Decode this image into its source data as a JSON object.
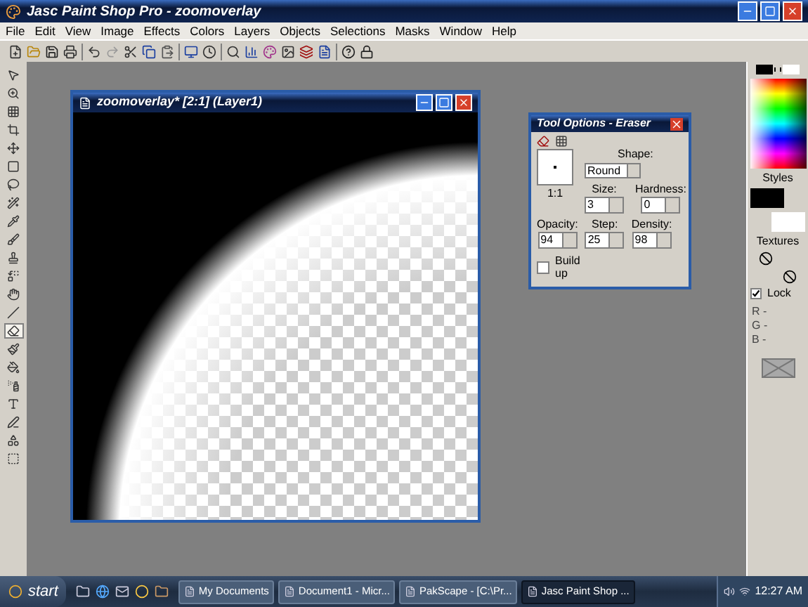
{
  "window": {
    "title": "Jasc Paint Shop Pro - zoomoverlay"
  },
  "menu": [
    "File",
    "Edit",
    "View",
    "Image",
    "Effects",
    "Colors",
    "Layers",
    "Objects",
    "Selections",
    "Masks",
    "Window",
    "Help"
  ],
  "tools": [
    {
      "kind": "pointer",
      "selected": false
    },
    {
      "kind": "zoom",
      "selected": false
    },
    {
      "kind": "deform",
      "selected": false
    },
    {
      "kind": "crop",
      "selected": false
    },
    {
      "kind": "move",
      "selected": false
    },
    {
      "kind": "selection",
      "selected": false
    },
    {
      "kind": "lasso",
      "selected": false
    },
    {
      "kind": "wand",
      "selected": false
    },
    {
      "kind": "dropper",
      "selected": false
    },
    {
      "kind": "brush",
      "selected": false
    },
    {
      "kind": "clone",
      "selected": false
    },
    {
      "kind": "replace",
      "selected": false
    },
    {
      "kind": "retouch",
      "selected": false
    },
    {
      "kind": "scratch",
      "selected": false
    },
    {
      "kind": "eraser",
      "selected": true
    },
    {
      "kind": "tube",
      "selected": false
    },
    {
      "kind": "fill",
      "selected": false
    },
    {
      "kind": "airbrush",
      "selected": false
    },
    {
      "kind": "text",
      "selected": false
    },
    {
      "kind": "draw",
      "selected": false
    },
    {
      "kind": "shapes",
      "selected": false
    },
    {
      "kind": "objectselect",
      "selected": false
    }
  ],
  "image_window": {
    "title": "zoomoverlay* [2:1] (Layer1)"
  },
  "tool_options": {
    "title": "Tool Options - Eraser",
    "preview_label": "1:1",
    "shape": {
      "label": "Shape:",
      "value": "Round"
    },
    "size": {
      "label": "Size:",
      "value": "3"
    },
    "hardness": {
      "label": "Hardness:",
      "value": "0"
    },
    "opacity": {
      "label": "Opacity:",
      "value": "94"
    },
    "step": {
      "label": "Step:",
      "value": "25"
    },
    "density": {
      "label": "Density:",
      "value": "98"
    },
    "build_up": {
      "label": "Build up",
      "checked": false
    }
  },
  "color_panel": {
    "styles_label": "Styles",
    "textures_label": "Textures",
    "lock": {
      "label": "Lock",
      "checked": true
    },
    "rgb": [
      "R -",
      "G -",
      "B -"
    ]
  },
  "taskbar": {
    "start": "start",
    "tasks": [
      {
        "label": "My Documents",
        "selected": false
      },
      {
        "label": "Document1 - Micr...",
        "selected": false
      },
      {
        "label": "PakScape - [C:\\Pr...",
        "selected": false
      },
      {
        "label": "Jasc Paint Shop ...",
        "selected": true
      }
    ],
    "clock": "12:27 AM"
  }
}
